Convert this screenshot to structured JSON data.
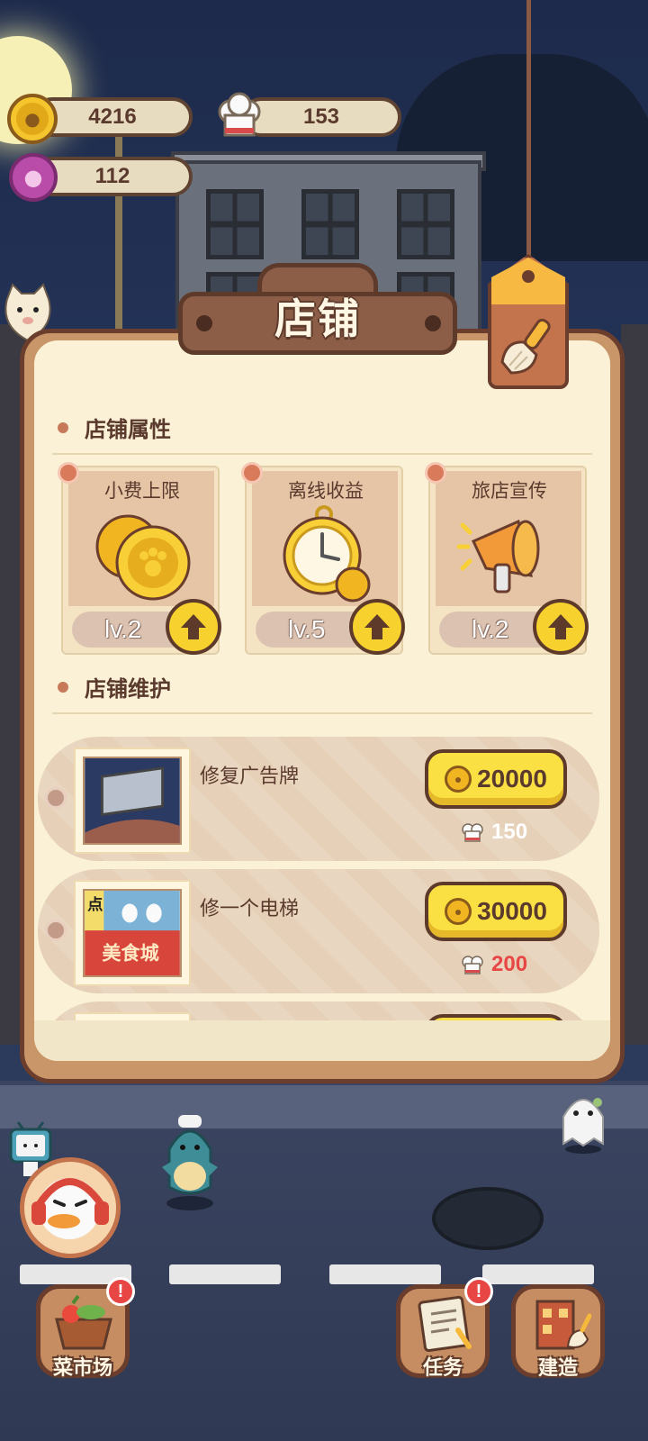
{
  "resources": {
    "coins": "4216",
    "chef_hats": "153",
    "paws": "112"
  },
  "panel": {
    "title": "店铺",
    "tag_icon": "broom-icon"
  },
  "attributes": {
    "section_title": "店铺属性",
    "cards": [
      {
        "label": "小费上限",
        "level": "lv.2",
        "icon": "coins-icon"
      },
      {
        "label": "离线收益",
        "level": "lv.5",
        "icon": "pocket-watch-icon"
      },
      {
        "label": "旅店宣传",
        "level": "lv.2",
        "icon": "megaphone-icon"
      }
    ]
  },
  "maintenance": {
    "section_title": "店铺维护",
    "items": [
      {
        "name": "修复广告牌",
        "coin_cost": "20000",
        "chef_cost": "150",
        "chef_cost_color": "#ffffff"
      },
      {
        "name": "修一个电梯",
        "coin_cost": "30000",
        "chef_cost": "200",
        "chef_cost_color": "#e84545",
        "pic_text": "美食城",
        "pic_side": "点"
      },
      {
        "name": "",
        "coin_cost": "",
        "chef_cost": ""
      }
    ]
  },
  "nav": {
    "market": "菜市场",
    "tasks": "任务",
    "build": "建造",
    "market_badge": "!",
    "tasks_badge": "!"
  },
  "colors": {
    "panel_bg": "#faf1d6",
    "accent_yellow": "#fbe043",
    "frame_brown": "#6a3d2c",
    "alert_red": "#e84545"
  }
}
